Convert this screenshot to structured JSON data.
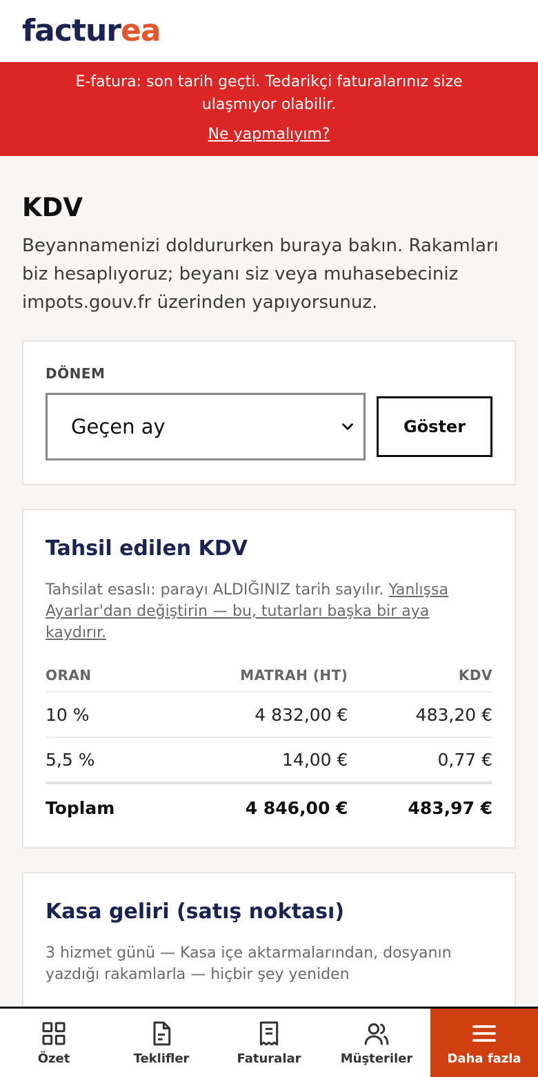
{
  "brand": {
    "part1": "factur",
    "part2": "ea",
    "color_primary": "#1b2352",
    "color_accent": "#e3562a"
  },
  "banner": {
    "text": "E-fatura: son tarih geçti. Tedarikçi faturalarınız size ulaşmıyor olabilir.",
    "link": "Ne yapmalıyım?",
    "color": "#dc2626"
  },
  "page": {
    "title": "KDV",
    "intro": "Beyannamenizi doldururken buraya bakın. Rakamları biz hesaplıyoruz; beyanı siz veya muhasebeciniz impots.gouv.fr üzerinden yapıyorsunuz."
  },
  "period": {
    "label": "DÖNEM",
    "selected": "Geçen ay",
    "button": "Göster"
  },
  "collected_vat": {
    "title": "Tahsil edilen KDV",
    "note_plain": "Tahsilat esaslı: parayı ALDIĞINIZ tarih sayılır. ",
    "note_link": "Yanlışsa Ayarlar'dan değiştirin — bu, tutarları başka bir aya kaydırır.",
    "headers": {
      "rate": "ORAN",
      "base": "MATRAH (HT)",
      "vat": "KDV"
    },
    "rows": [
      {
        "rate": "10 %",
        "base": "4 832,00 €",
        "vat": "483,20 €"
      },
      {
        "rate": "5,5 %",
        "base": "14,00 €",
        "vat": "0,77 €"
      }
    ],
    "total": {
      "label": "Toplam",
      "base": "4 846,00 €",
      "vat": "483,97 €"
    }
  },
  "cash_income": {
    "title": "Kasa geliri (satış noktası)",
    "note": "3 hizmet günü — Kasa içe aktarmalarından, dosyanın yazdığı rakamlarla — hiçbir şey yeniden"
  },
  "nav": {
    "items": [
      {
        "label": "Özet",
        "icon": "grid-icon"
      },
      {
        "label": "Teklifler",
        "icon": "document-icon"
      },
      {
        "label": "Faturalar",
        "icon": "receipt-icon"
      },
      {
        "label": "Müşteriler",
        "icon": "users-icon"
      },
      {
        "label": "Daha fazla",
        "icon": "menu-icon"
      }
    ],
    "active_color": "#cf3f10"
  }
}
